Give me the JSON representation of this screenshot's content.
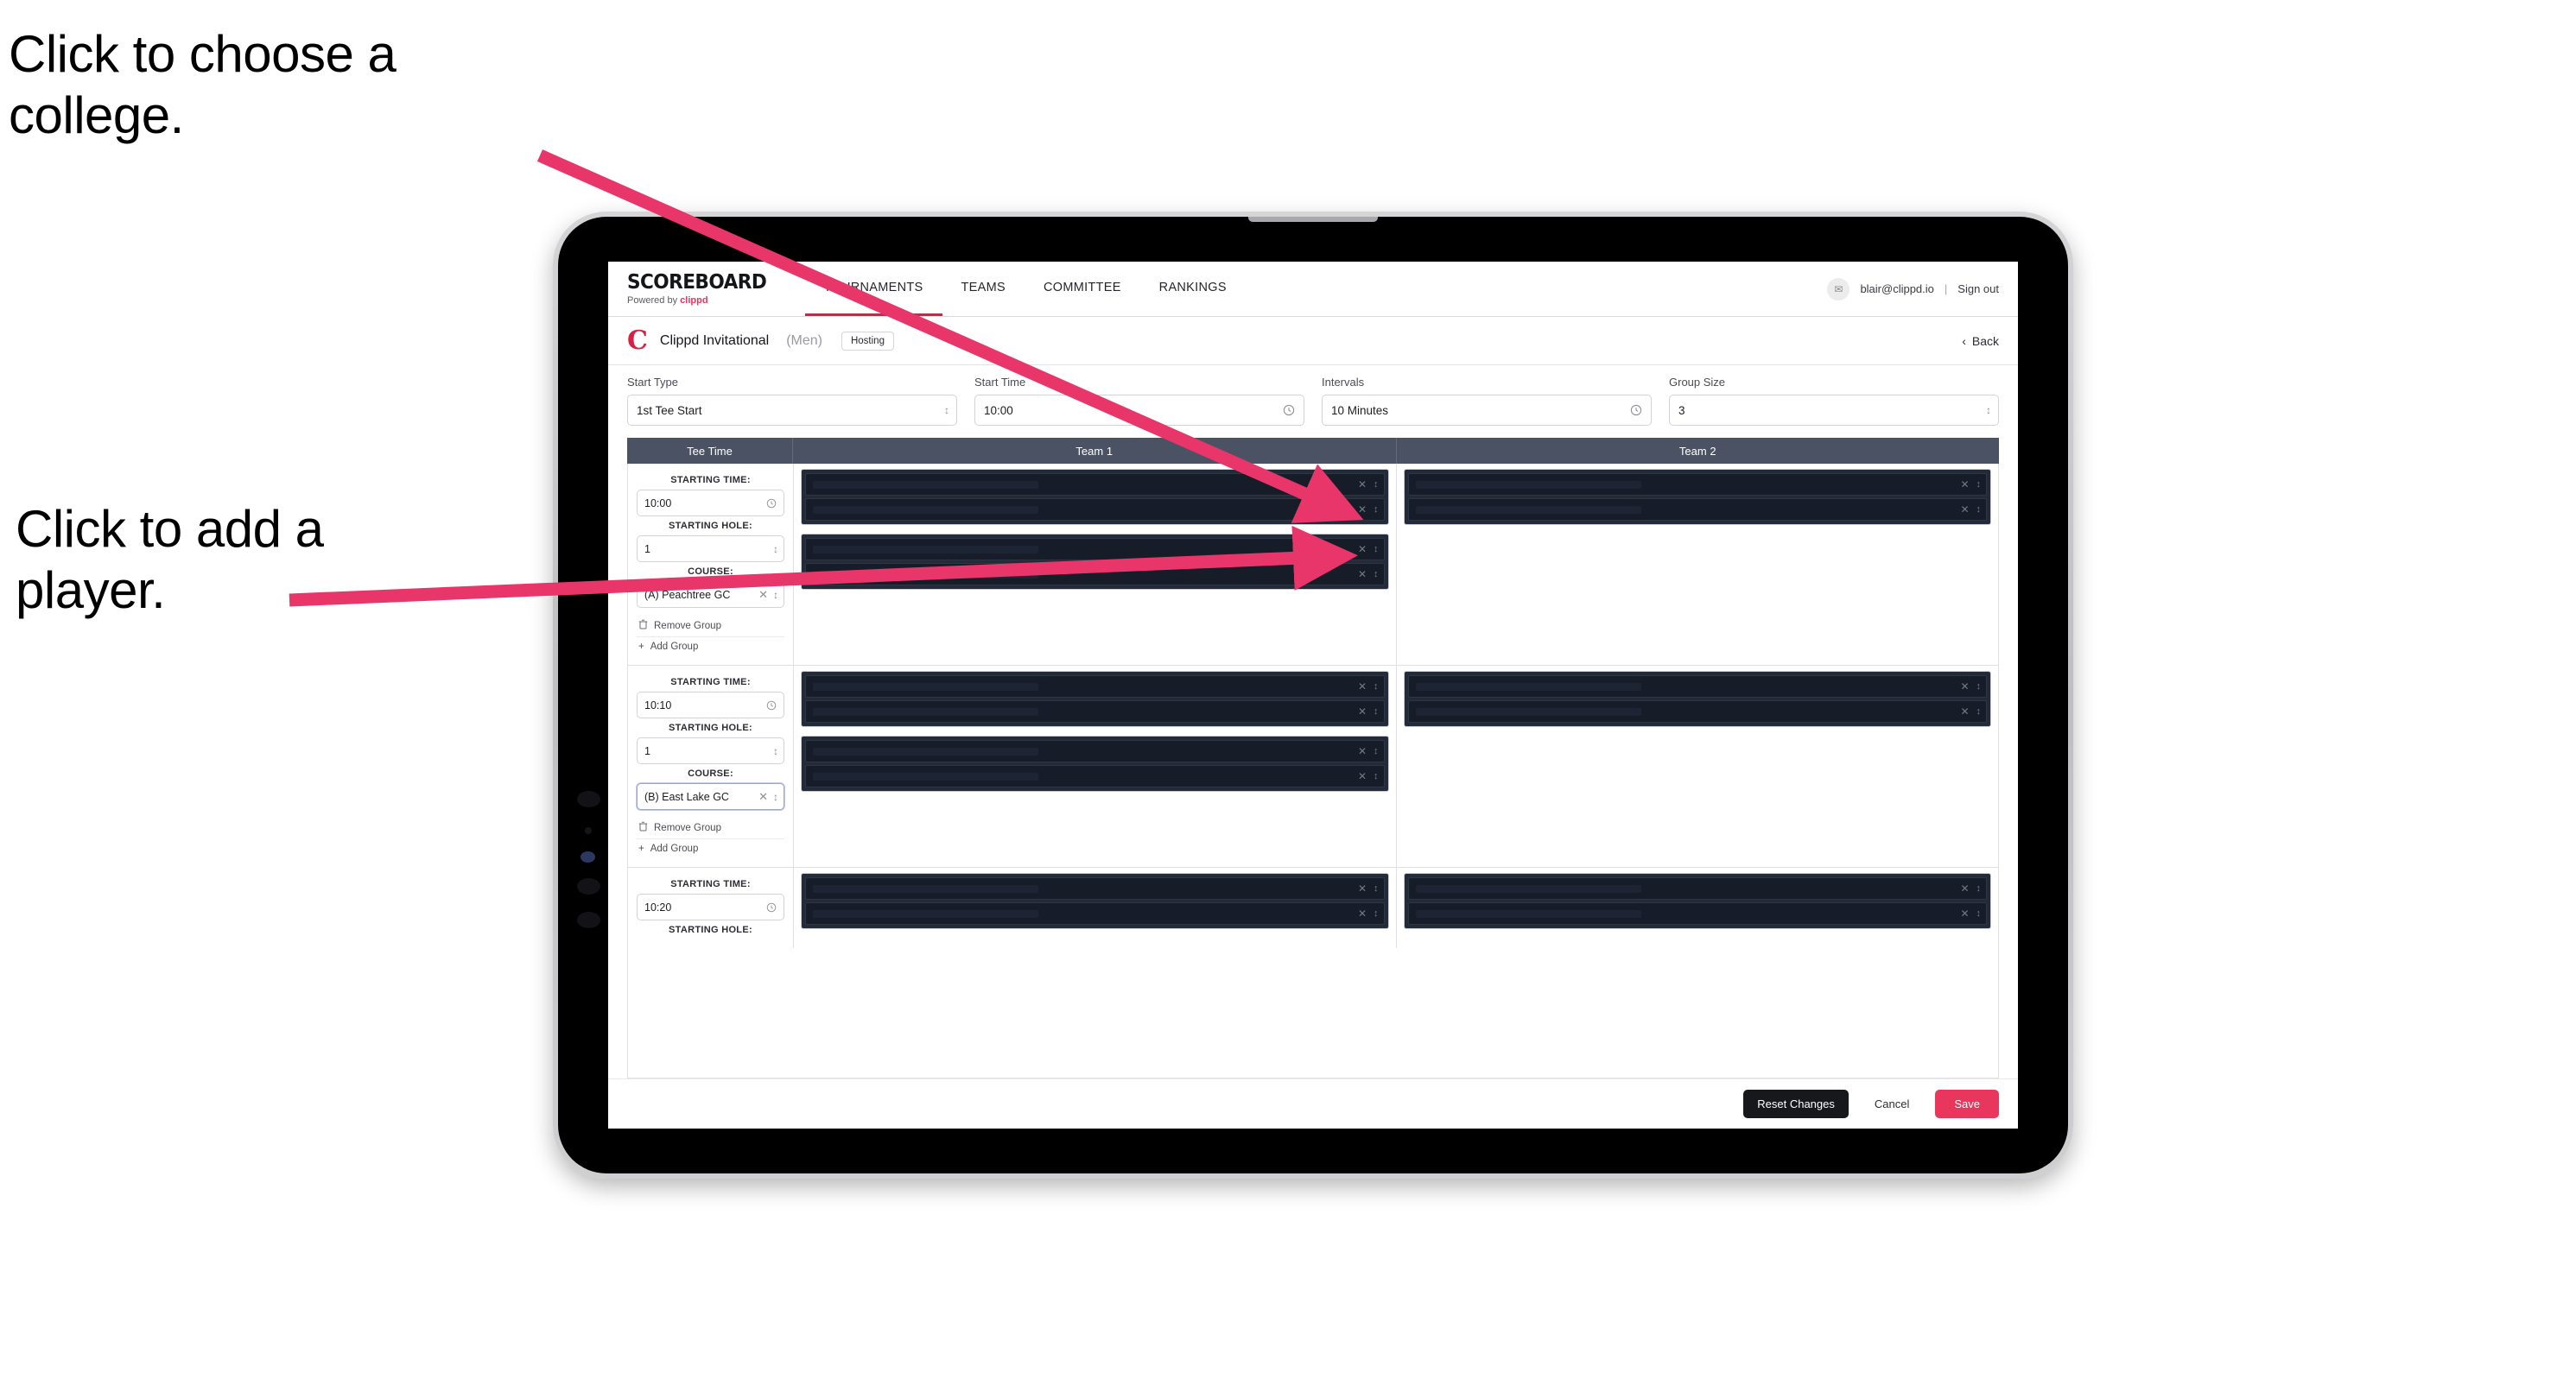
{
  "annotations": {
    "college": "Click to choose a college.",
    "player": "Click to add a player.",
    "arrow_color": "#e8356a"
  },
  "header": {
    "brand_title": "SCOREBOARD",
    "brand_sub_prefix": "Powered by ",
    "brand_sub_name": "clippd",
    "nav": [
      {
        "label": "TOURNAMENTS",
        "active": true
      },
      {
        "label": "TEAMS",
        "active": false
      },
      {
        "label": "COMMITTEE",
        "active": false
      },
      {
        "label": "RANKINGS",
        "active": false
      }
    ],
    "user_email": "blair@clippd.io",
    "separator": "|",
    "sign_out": "Sign out",
    "avatar_glyph": "✉",
    "accent_color": "#d81f44"
  },
  "tournament": {
    "logo_letter": "C",
    "name": "Clippd Invitational",
    "gender": "(Men)",
    "status_badge": "Hosting",
    "back_label": "Back",
    "back_chevron": "‹"
  },
  "settings": {
    "fields": [
      {
        "label": "Start Type",
        "value": "1st Tee Start",
        "control": "stepper"
      },
      {
        "label": "Start Time",
        "value": "10:00",
        "control": "clock"
      },
      {
        "label": "Intervals",
        "value": "10 Minutes",
        "control": "clock"
      },
      {
        "label": "Group Size",
        "value": "3",
        "control": "stepper"
      }
    ]
  },
  "table": {
    "columns": [
      "Tee Time",
      "Team 1",
      "Team 2"
    ],
    "labels": {
      "starting_time": "STARTING TIME:",
      "starting_hole": "STARTING HOLE:",
      "course": "COURSE:",
      "remove_group": "Remove Group",
      "add_group": "Add Group",
      "trash_icon": "☐",
      "plus_icon": "+"
    },
    "groups": [
      {
        "starting_time": "10:00",
        "starting_hole": "1",
        "course": "(A) Peachtree GC",
        "course_focused": false,
        "truncated": false,
        "team1_blocks": 2,
        "team2_blocks": 1,
        "slots_per_block": 2
      },
      {
        "starting_time": "10:10",
        "starting_hole": "1",
        "course": "(B) East Lake GC",
        "course_focused": true,
        "truncated": false,
        "team1_blocks": 2,
        "team2_blocks": 1,
        "slots_per_block": 2
      },
      {
        "starting_time": "10:20",
        "starting_hole": "",
        "course": "",
        "course_focused": false,
        "truncated": true,
        "team1_blocks": 1,
        "team2_blocks": 1,
        "slots_per_block": 2
      }
    ]
  },
  "footer": {
    "reset_label": "Reset Changes",
    "cancel_label": "Cancel",
    "save_label": "Save",
    "save_color": "#e8365d"
  }
}
